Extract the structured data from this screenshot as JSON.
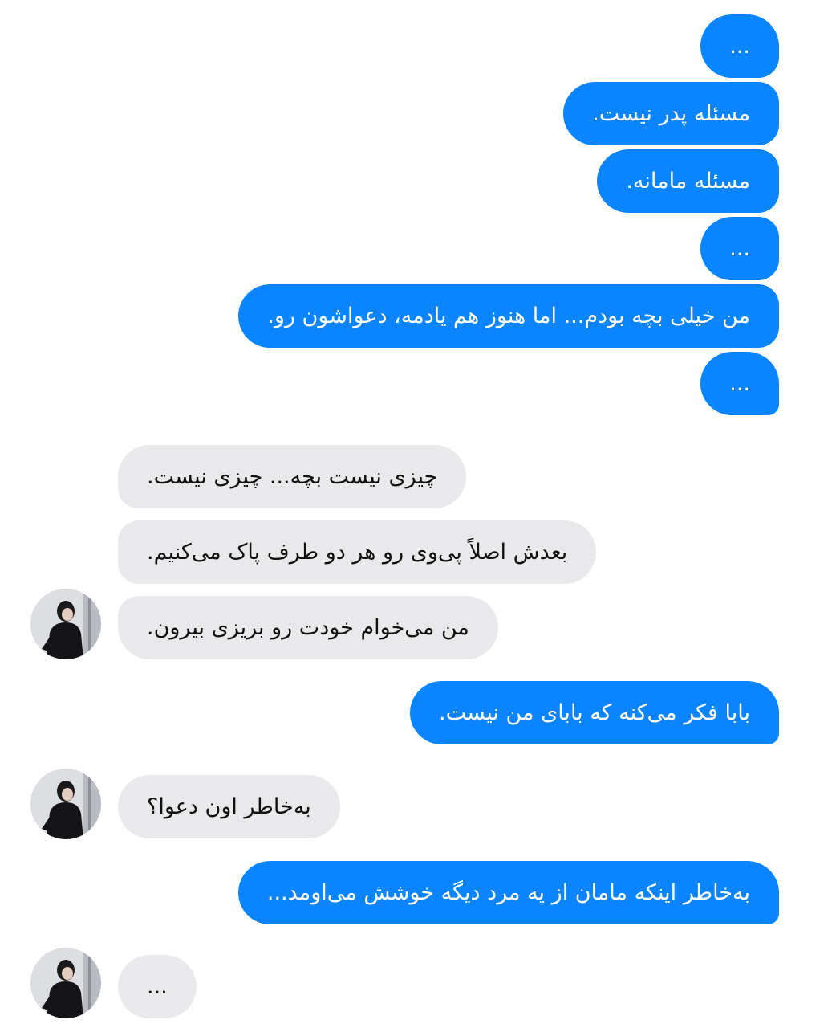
{
  "messages": [
    {
      "side": "out",
      "text": "..."
    },
    {
      "side": "out",
      "text": "مسئله پدر نیست."
    },
    {
      "side": "out",
      "text": "مسئله مامانه."
    },
    {
      "side": "out",
      "text": "..."
    },
    {
      "side": "out",
      "text": "من خیلی بچه بودم... اما هنوز هم یادمه، دعواشون رو."
    },
    {
      "side": "out",
      "text": "..."
    },
    {
      "side": "in",
      "text": "چیزی نیست بچه... چیزی نیست."
    },
    {
      "side": "in",
      "text": "بعدش اصلاً پی‌وی رو هر دو طرف پاک می‌کنیم."
    },
    {
      "side": "in",
      "text": "من می‌خوام خودت رو بریزی بیرون."
    },
    {
      "side": "out",
      "text": "بابا فکر می‌کنه که بابای من نیست."
    },
    {
      "side": "in",
      "text": "به‌خاطر اون دعوا؟"
    },
    {
      "side": "out",
      "text": "به‌خاطر اینکه مامان از یه مرد دیگه خوشش می‌اومد..."
    },
    {
      "side": "in",
      "text": "..."
    }
  ],
  "avatar_icon": "person-in-black-turtleneck-avatar",
  "colors": {
    "outgoing_bubble": "#0a84ff",
    "incoming_bubble": "#e9e9eb"
  }
}
